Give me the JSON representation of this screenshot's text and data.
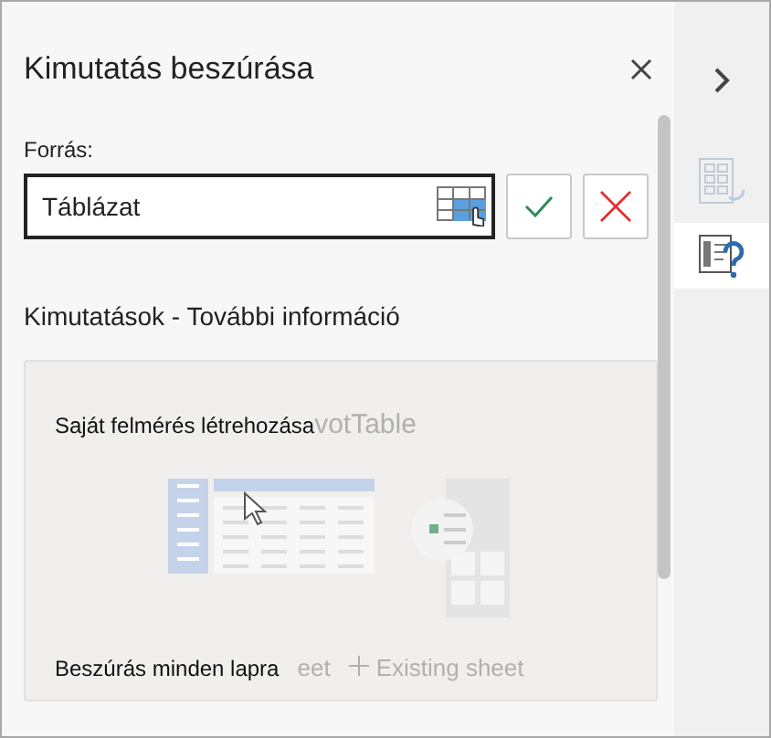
{
  "pane": {
    "title": "Kimutatás beszúrása",
    "source_label": "Forrás:",
    "source_field": {
      "value": "Táblázat"
    },
    "link": "Kimutatások - További információ",
    "card": {
      "title": "Saját felmérés létrehozása",
      "faded_title": "votTable",
      "footer": "Beszúrás minden lapra",
      "faded_option": "eet",
      "faded_option_2": "Existing sheet"
    }
  },
  "side_tabs": [
    {
      "kind": "collapse",
      "selected": false
    },
    {
      "kind": "fields",
      "selected": false
    },
    {
      "kind": "help",
      "selected": true
    }
  ]
}
